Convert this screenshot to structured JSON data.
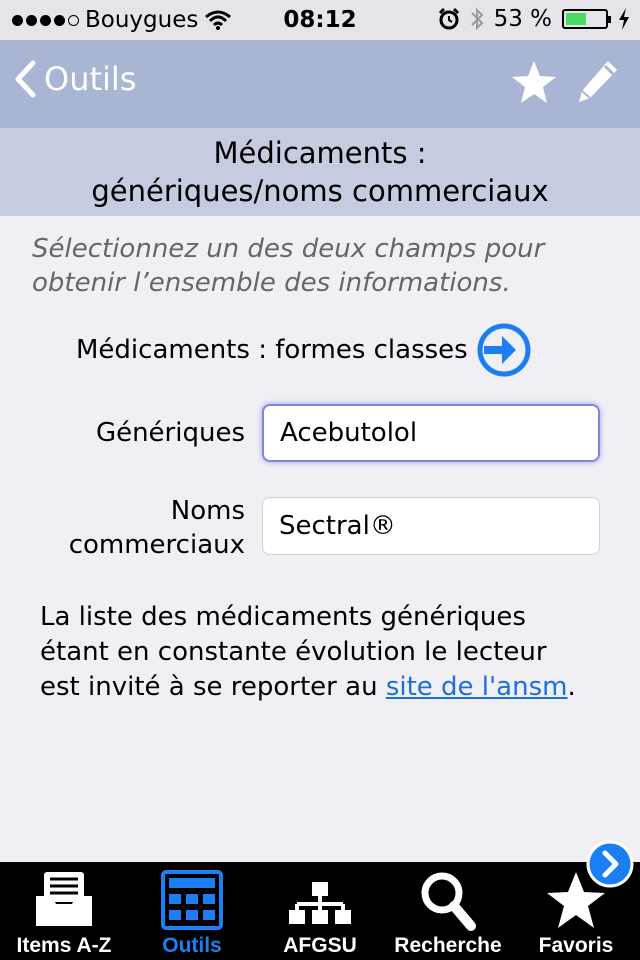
{
  "status_bar": {
    "carrier": "Bouygues",
    "time": "08:12",
    "battery": "53 %",
    "battery_level": 0.53
  },
  "nav": {
    "back_label": "Outils",
    "icons": [
      "star-icon",
      "pencil-icon"
    ]
  },
  "title": {
    "line1": "Médicaments :",
    "line2": "génériques/noms commerciaux"
  },
  "instructions": {
    "line1": "Sélectionnez un des deux champs pour",
    "line2": "obtenir l’ensemble des informations."
  },
  "classes_link": "Médicaments : formes classes",
  "fields": {
    "generic_label": "Génériques",
    "generic_value": "Acebutolol",
    "commercial_label_1": "Noms",
    "commercial_label_2": "commerciaux",
    "commercial_value": "Sectral®"
  },
  "note": {
    "line1": "La liste des médicaments génériques",
    "line2": "étant en constante évolution le lecteur",
    "line3_prefix": "est invité à se reporter au ",
    "link_text": "site de l'ansm",
    "line3_suffix": "."
  },
  "tabs": [
    {
      "label": "Items A-Z",
      "icon": "inbox-icon",
      "active": false
    },
    {
      "label": "Outils",
      "icon": "calculator-icon",
      "active": true
    },
    {
      "label": "AFGSU",
      "icon": "hierarchy-icon",
      "active": false
    },
    {
      "label": "Recherche",
      "icon": "search-icon",
      "active": false
    },
    {
      "label": "Favoris",
      "icon": "star-icon",
      "active": false
    }
  ],
  "colors": {
    "nav_bar": "#aab5d3",
    "title_band": "#c5ccdf",
    "accent": "#1b7ef5",
    "link": "#1b6fe0"
  }
}
